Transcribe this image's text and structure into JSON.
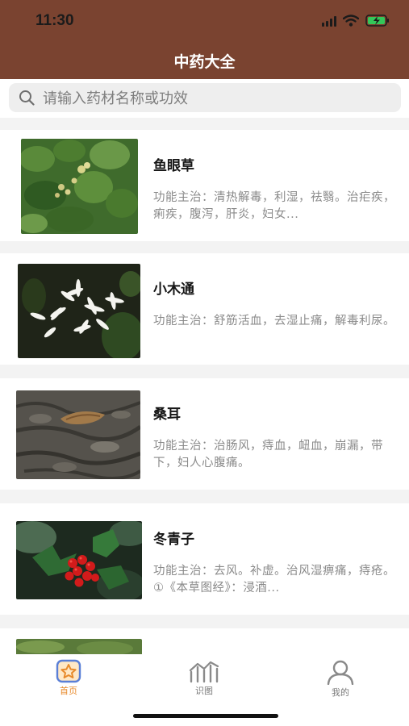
{
  "status_bar": {
    "time": "11:30",
    "icons": [
      "signal-icon",
      "wifi-icon",
      "battery-charging-icon"
    ]
  },
  "header": {
    "title": "中药大全",
    "background_color": "#7a4330"
  },
  "search": {
    "placeholder": "请输入药材名称或功效",
    "icon": "search-icon"
  },
  "herbs": [
    {
      "name": "鱼眼草",
      "description": "功能主治：清热解毒，利湿，祛翳。治疟疾，痢疾，腹泻，肝炎，妇女...",
      "image": "green-leaves-photo"
    },
    {
      "name": "小木通",
      "description": "功能主治：舒筋活血，去湿止痛，解毒利尿。",
      "image": "white-flowers-photo"
    },
    {
      "name": "桑耳",
      "description": "功能主治：治肠风，痔血，衄血，崩漏，带下，妇人心腹痛。",
      "image": "tree-bark-fungus-photo"
    },
    {
      "name": "冬青子",
      "description": "功能主治：去风。补虚。治风湿痹痛，痔疮。①《本草图经》：浸酒...",
      "image": "holly-berries-photo"
    }
  ],
  "tabbar": {
    "tabs": [
      {
        "label": "首页",
        "icon": "home-star-icon",
        "active": true
      },
      {
        "label": "识图",
        "icon": "chart-scan-icon",
        "active": false
      },
      {
        "label": "我的",
        "icon": "user-icon",
        "active": false
      }
    ],
    "active_color": "#e88a2b",
    "inactive_color": "#7a7a7a"
  }
}
